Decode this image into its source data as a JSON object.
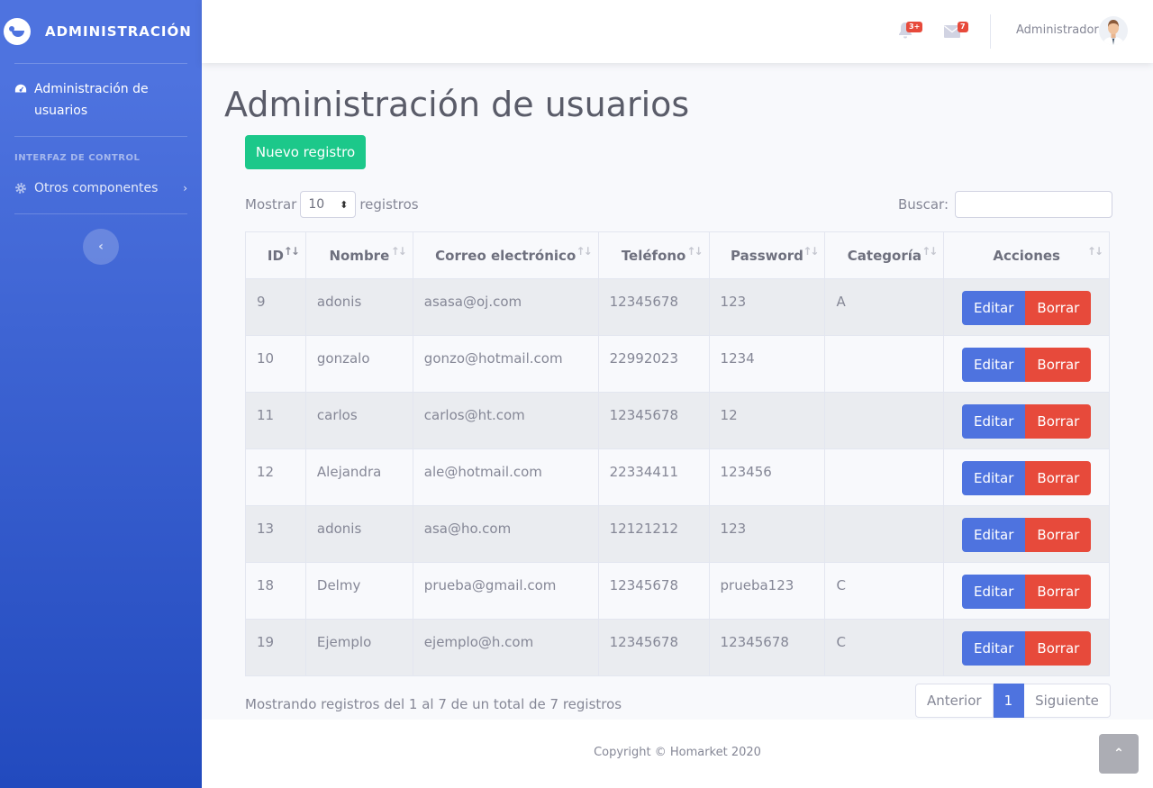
{
  "sidebar": {
    "brand": "ADMINISTRACIÓN",
    "active_item": "Administración de usuarios",
    "heading": "INTERFAZ DE CONTROL",
    "sub_item": "Otros componentes",
    "toggle_glyph": "‹",
    "icons": [
      "tachometer-icon",
      "cog-icon",
      "chevron-right-icon",
      "brand-logo-icon"
    ]
  },
  "topbar": {
    "alerts_badge": "3+",
    "messages_badge": "7",
    "user_name": "Administrador"
  },
  "main": {
    "title": "Administración de usuarios",
    "new_button": "Nuevo registro",
    "show_label": "Mostrar",
    "show_value": "10",
    "records_label": "registros",
    "search_label": "Buscar:",
    "search_value": ""
  },
  "table": {
    "headers": [
      "ID",
      "Nombre",
      "Correo electrónico",
      "Teléfono",
      "Password",
      "Categoría",
      "Acciones"
    ],
    "edit_label": "Editar",
    "delete_label": "Borrar",
    "rows": [
      [
        "9",
        "adonis",
        "asasa@oj.com",
        "12345678",
        "123",
        "A"
      ],
      [
        "10",
        "gonzalo",
        "gonzo@hotmail.com",
        "22992023",
        "1234",
        ""
      ],
      [
        "11",
        "carlos",
        "carlos@ht.com",
        "12345678",
        "12",
        ""
      ],
      [
        "12",
        "Alejandra",
        "ale@hotmail.com",
        "22334411",
        "123456",
        ""
      ],
      [
        "13",
        "adonis",
        "asa@ho.com",
        "12121212",
        "123",
        ""
      ],
      [
        "18",
        "Delmy",
        "prueba@gmail.com",
        "12345678",
        "prueba123",
        "C"
      ],
      [
        "19",
        "Ejemplo",
        "ejemplo@h.com",
        "12345678",
        "12345678",
        "C"
      ]
    ]
  },
  "pagination": {
    "info": "Mostrando registros del 1 al 7 de un total de 7 registros",
    "prev": "Anterior",
    "current": "1",
    "next": "Siguiente"
  },
  "footer": {
    "copyright": "Copyright © Homarket 2020"
  },
  "colors": {
    "primary": "#4e73df",
    "success": "#1cc88a",
    "danger": "#e74a3b"
  }
}
